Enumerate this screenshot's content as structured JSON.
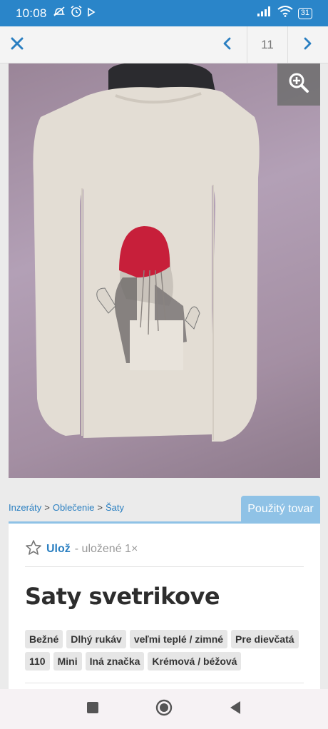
{
  "status": {
    "time": "10:08",
    "battery": "31",
    "left_icons": [
      "muted-notification-icon",
      "alarm-icon",
      "play-icon"
    ],
    "right_icons": [
      "signal-icon",
      "wifi-icon",
      "battery-icon"
    ]
  },
  "topbar": {
    "counter": "11",
    "icons": [
      "close-icon",
      "chevron-left-icon",
      "chevron-right-icon"
    ]
  },
  "photo": {
    "icons": [
      "zoom-in-icon"
    ]
  },
  "breadcrumb": {
    "items": [
      "Inzeráty",
      "Oblečenie",
      "Šaty"
    ],
    "separator": ">"
  },
  "condition_badge": "Použitý tovar",
  "listing": {
    "save_label": "Ulož",
    "save_count": "- uložené 1×",
    "title": "Saty svetrikove",
    "tags": [
      "Bežné",
      "Dlhý rukáv",
      "veľmi teplé / zimné",
      "Pre dievčatá",
      "110",
      "Mini",
      "Iná značka",
      "Krémová / béžová"
    ]
  },
  "colors": {
    "status_bar": "#2a85c9",
    "link": "#2a7fc1",
    "badge": "#8fc2e6",
    "title_text": "#2d2d2d"
  },
  "android_nav": {
    "icons": [
      "recents-icon",
      "home-icon",
      "back-icon"
    ]
  }
}
